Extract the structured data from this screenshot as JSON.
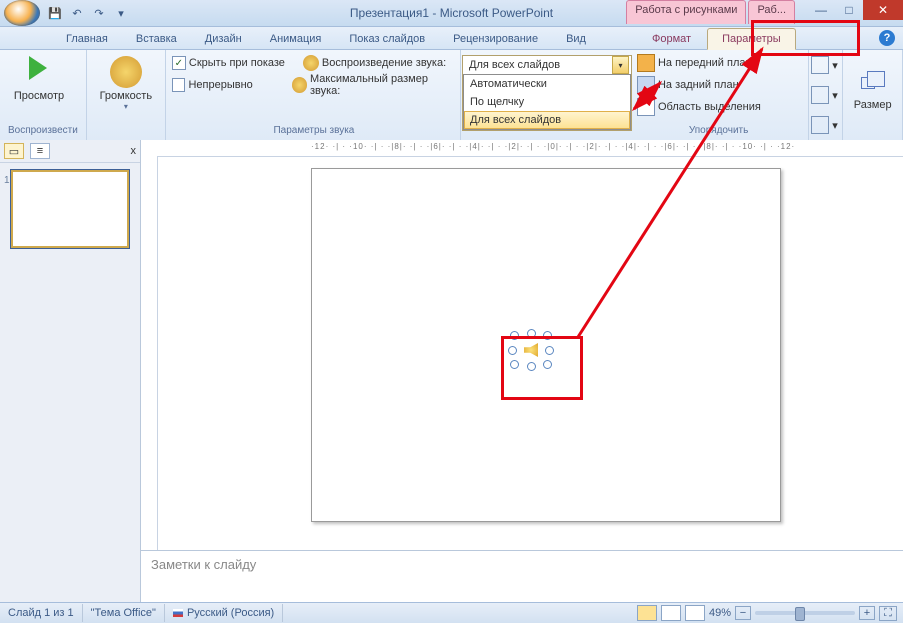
{
  "titlebar": {
    "title": "Презентация1 - Microsoft PowerPoint",
    "context_tabs": [
      "Работа с рисунками",
      "Раб..."
    ]
  },
  "tabs": {
    "items": [
      "Главная",
      "Вставка",
      "Дизайн",
      "Анимация",
      "Показ слайдов",
      "Рецензирование",
      "Вид",
      "Формат",
      "Параметры"
    ],
    "active": "Параметры"
  },
  "ribbon": {
    "play": {
      "preview": "Просмотр",
      "group": "Воспроизвести"
    },
    "volume": {
      "label": "Громкость"
    },
    "options": {
      "hide": "Скрыть при показе",
      "loop": "Непрерывно",
      "play_sound": "Воспроизведение звука:",
      "max_size": "Максимальный размер звука:",
      "group": "Параметры звука"
    },
    "dropdown": {
      "selected": "Для всех слайдов",
      "items": [
        "Автоматически",
        "По щелчку",
        "Для всех слайдов"
      ],
      "hover": "Для всех слайдов"
    },
    "arrange": {
      "front": "На передний план",
      "back": "На задний план",
      "selection": "Область выделения",
      "group": "Упорядочить"
    },
    "size": {
      "label": "Размер"
    }
  },
  "thumb": {
    "close": "x",
    "num": "1"
  },
  "ruler": "·12· ·| · ·10· ·| · ·|8|· ·| · ·|6|· ·| · ·|4|· ·| · ·|2|· ·| · ·|0|· ·| · ·|2|· ·| · ·|4|· ·| · ·|6|· ·| · ·|8|· ·| · ·10· ·| · ·12·",
  "notes": {
    "placeholder": "Заметки к слайду"
  },
  "status": {
    "slide": "Слайд 1 из 1",
    "theme": "\"Тема Office\"",
    "lang": "Русский (Россия)",
    "zoom": "49%"
  }
}
